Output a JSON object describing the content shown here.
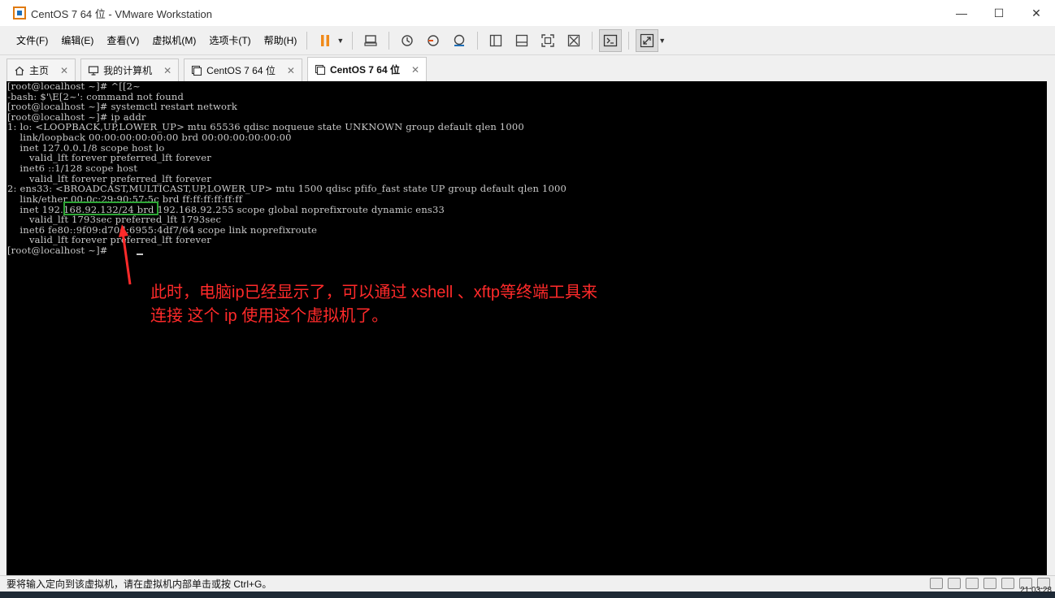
{
  "window": {
    "title": "CentOS 7 64 位 - VMware Workstation",
    "controls": [
      "—",
      "☐",
      "✕"
    ]
  },
  "menu": [
    "文件(F)",
    "编辑(E)",
    "查看(V)",
    "虚拟机(M)",
    "选项卡(T)",
    "帮助(H)"
  ],
  "toolbar": {
    "buttons": [
      "pause-icon",
      "send-keys-icon",
      "snapshot-icon",
      "revert-snapshot-icon",
      "snapshot-manager-icon",
      "library-icon",
      "thumbnail-icon",
      "fullscreen-icon",
      "unity-icon",
      "console-icon",
      "stretch-icon"
    ]
  },
  "tabs": [
    {
      "label": "主页",
      "icon": "home-icon",
      "active": false
    },
    {
      "label": "我的计算机",
      "icon": "computer-icon",
      "active": false
    },
    {
      "label": "CentOS 7 64 位",
      "icon": "vm-icon",
      "active": false
    },
    {
      "label": "CentOS 7 64 位",
      "icon": "vm-icon",
      "active": true
    }
  ],
  "terminal": {
    "lines": [
      "[root@localhost ~]# ^[[2~",
      "-bash: $'\\E[2~': command not found",
      "[root@localhost ~]# systemctl restart network",
      "[root@localhost ~]# ip addr",
      "1: lo: <LOOPBACK,UP,LOWER_UP> mtu 65536 qdisc noqueue state UNKNOWN group default qlen 1000",
      "    link/loopback 00:00:00:00:00:00 brd 00:00:00:00:00:00",
      "    inet 127.0.0.1/8 scope host lo",
      "       valid_lft forever preferred_lft forever",
      "    inet6 ::1/128 scope host",
      "       valid_lft forever preferred_lft forever",
      "2: ens33: <BROADCAST,MULTICAST,UP,LOWER_UP> mtu 1500 qdisc pfifo_fast state UP group default qlen 1000",
      "    link/ether 00:0c:29:90:57:5c brd ff:ff:ff:ff:ff:ff",
      "    inet 192.168.92.132/24 brd 192.168.92.255 scope global noprefixroute dynamic ens33",
      "       valid_lft 1793sec preferred_lft 1793sec",
      "    inet6 fe80::9f09:d70d:6955:4df7/64 scope link noprefixroute",
      "       valid_lft forever preferred_lft forever",
      "[root@localhost ~]# "
    ]
  },
  "annotation": {
    "line1": "此时，电脑ip已经显示了，可以通过 xshell 、xftp等终端工具来",
    "line2": "连接 这个 ip 使用这个虚拟机了。",
    "color": "#ff2a2a",
    "highlight_color": "#2da635"
  },
  "status": {
    "text": "要将输入定向到该虚拟机，请在虚拟机内部单击或按 Ctrl+G。"
  },
  "clock": "21:03:28"
}
